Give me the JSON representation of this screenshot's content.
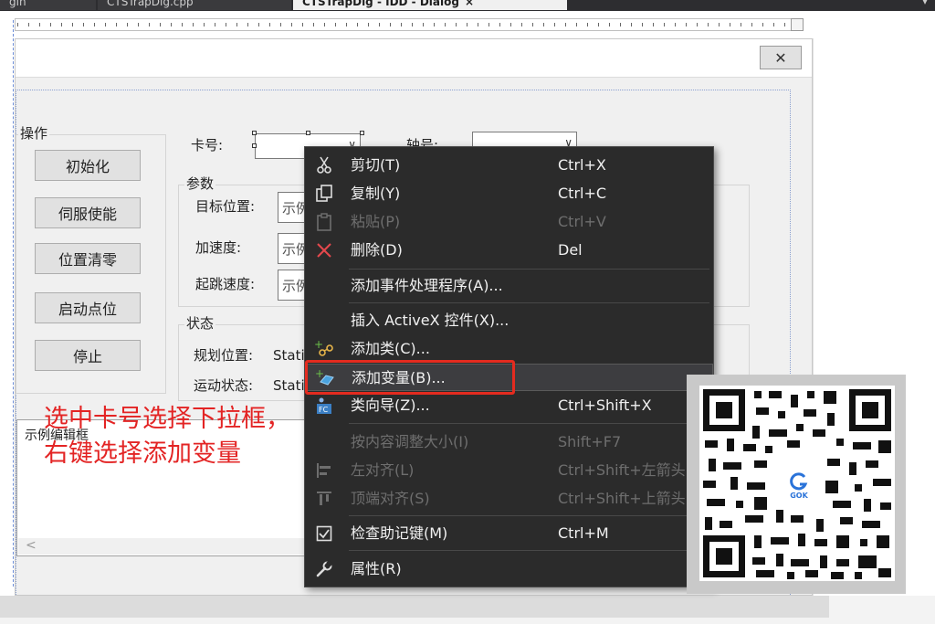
{
  "tabs": [
    {
      "label": "gin"
    },
    {
      "label": "CTSTrapDlg.cpp"
    },
    {
      "label": "CTSTrapDlg - IDD - Dialog",
      "close": "×"
    }
  ],
  "dialog": {
    "close_glyph": "✕",
    "operation_group": {
      "label": "操作",
      "buttons": [
        "初始化",
        "伺服使能",
        "位置清零",
        "启动点位",
        "停止"
      ]
    },
    "card_label": "卡号:",
    "axis_label": "轴号:",
    "params_group": {
      "label": "参数",
      "fields": [
        {
          "label": "目标位置:",
          "value": "示例"
        },
        {
          "label": "加速度:",
          "value": "示例"
        },
        {
          "label": "起跳速度:",
          "value": "示例"
        }
      ]
    },
    "status_group": {
      "label": "状态",
      "fields": [
        {
          "label": "规划位置:",
          "value": "Static"
        },
        {
          "label": "运动状态:",
          "value": "Static"
        }
      ]
    },
    "example_edit": "示例编辑框",
    "scroll_left": "<"
  },
  "annotation": {
    "line1": "选中卡号选择下拉框，",
    "line2": "右键选择添加变量"
  },
  "context_menu": {
    "items": [
      {
        "label": "剪切(T)",
        "shortcut": "Ctrl+X",
        "icon": "scissors-icon",
        "disabled": false
      },
      {
        "label": "复制(Y)",
        "shortcut": "Ctrl+C",
        "icon": "copy-icon",
        "disabled": false
      },
      {
        "label": "粘贴(P)",
        "shortcut": "Ctrl+V",
        "icon": "paste-icon",
        "disabled": true
      },
      {
        "label": "删除(D)",
        "shortcut": "Del",
        "icon": "delete-icon",
        "disabled": false
      },
      {
        "label": "添加事件处理程序(A)...",
        "shortcut": "",
        "icon": "",
        "disabled": false
      },
      {
        "label": "插入 ActiveX 控件(X)...",
        "shortcut": "",
        "icon": "",
        "disabled": false
      },
      {
        "label": "添加类(C)...",
        "shortcut": "",
        "icon": "add-class-icon",
        "disabled": false
      },
      {
        "label": "添加变量(B)...",
        "shortcut": "",
        "icon": "add-variable-icon",
        "disabled": false
      },
      {
        "label": "类向导(Z)...",
        "shortcut": "Ctrl+Shift+X",
        "icon": "class-wizard-icon",
        "disabled": false
      },
      {
        "label": "按内容调整大小(I)",
        "shortcut": "Shift+F7",
        "icon": "",
        "disabled": true
      },
      {
        "label": "左对齐(L)",
        "shortcut": "Ctrl+Shift+左箭头",
        "icon": "align-left-icon",
        "disabled": true
      },
      {
        "label": "顶端对齐(S)",
        "shortcut": "Ctrl+Shift+上箭头",
        "icon": "align-top-icon",
        "disabled": true
      },
      {
        "label": "检查助记键(M)",
        "shortcut": "Ctrl+M",
        "icon": "check-mnemonic-icon",
        "disabled": false
      },
      {
        "label": "属性(R)",
        "shortcut": "",
        "icon": "wrench-icon",
        "disabled": false
      }
    ]
  },
  "qr_logo_text": "GOK",
  "colors": {
    "menu_bg": "#2b2b2b",
    "highlight_box": "#e42b1f",
    "annotation": "#e32424",
    "dialog_bg": "#f0f0f0"
  }
}
